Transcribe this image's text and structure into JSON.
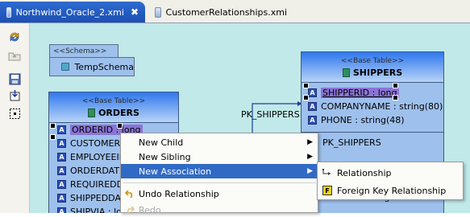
{
  "tabs": [
    {
      "label": "Northwind_Oracle_2.xmi",
      "active": true,
      "close": "✖"
    },
    {
      "label": "CustomerRelationships.xmi",
      "active": false
    }
  ],
  "palette": {
    "icons": [
      "refresh-icon",
      "up-folder-icon",
      "save-icon",
      "import-icon",
      "marquee-select-icon"
    ]
  },
  "schema": {
    "stereotype": "<<Schema>>",
    "name": "TempSchema"
  },
  "tables": {
    "orders": {
      "stereotype": "<<Base Table>>",
      "name": "ORDERS",
      "columns": [
        {
          "icon": "A",
          "text": "ORDERID : long"
        },
        {
          "icon": "A",
          "text": "CUSTOMERID"
        },
        {
          "icon": "A",
          "text": "EMPLOYEEID"
        },
        {
          "icon": "A",
          "text": "ORDERDATE"
        },
        {
          "icon": "A",
          "text": "REQUIREDD"
        },
        {
          "icon": "A",
          "text": "SHIPPEDDAT"
        },
        {
          "icon": "A",
          "text": "SHIPVIA : lon"
        }
      ]
    },
    "shippers": {
      "stereotype": "<<Base Table>>",
      "name": "SHIPPERS",
      "columns": [
        {
          "icon": "A",
          "text": "SHIPPERID : long"
        },
        {
          "icon": "A",
          "text": "COMPANYNAME : string(80)"
        },
        {
          "icon": "A",
          "text": "PHONE : string(48)"
        }
      ],
      "keys": [
        "PK_SHIPPERS"
      ],
      "lower_row": "ORDERID : long"
    }
  },
  "connection_label": "PK_SHIPPERS",
  "context_menu": {
    "items": [
      {
        "label": "New Child",
        "submenu": true
      },
      {
        "label": "New Sibling",
        "submenu": true
      },
      {
        "label": "New Association",
        "submenu": true,
        "highlighted": true
      },
      {
        "label": "Undo Relationship"
      },
      {
        "label": "Redo",
        "disabled": true
      }
    ]
  },
  "submenu": {
    "items": [
      {
        "label": "Relationship",
        "icon": "relationship-icon"
      },
      {
        "label": "Foreign Key Relationship",
        "icon": "foreign-key-icon",
        "badge": "F"
      }
    ]
  },
  "colors": {
    "canvas": "#c1e9e9",
    "table_fill": "#9ec0ec",
    "table_header_top": "#2f78ee",
    "menu_highlight": "#316ac5",
    "active_tab": "#1c4fb3"
  }
}
